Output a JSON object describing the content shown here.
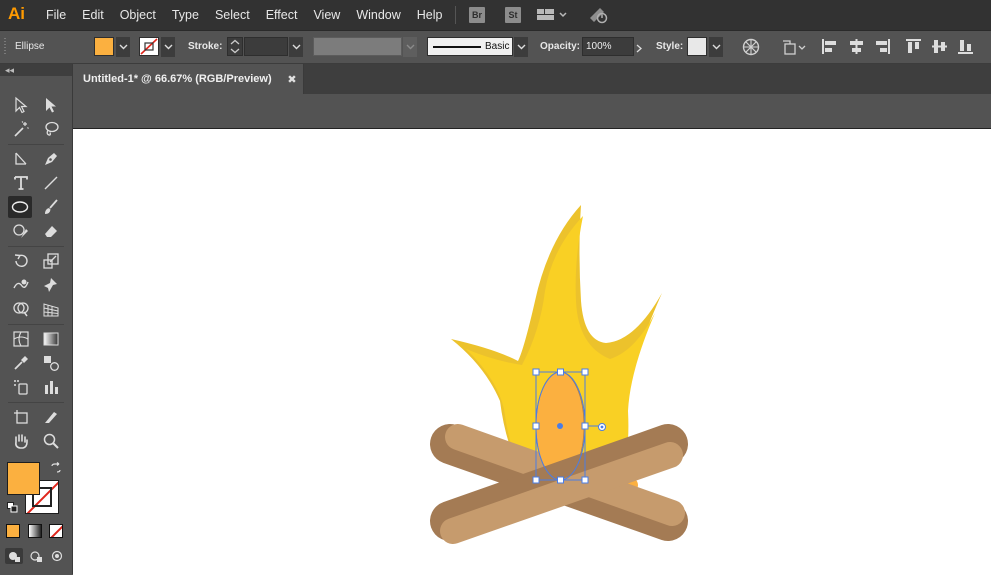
{
  "app": {
    "logo_text": "Ai"
  },
  "menubar": {
    "items": [
      "File",
      "Edit",
      "Object",
      "Type",
      "Select",
      "Effect",
      "View",
      "Window",
      "Help"
    ],
    "bridge_badge": "Br",
    "stock_badge": "St",
    "arrange_icon": "workspace-arrange-icon",
    "gpu_icon": "gpu-performance-icon"
  },
  "controlbar": {
    "selection_label": "Ellipse",
    "fill_color": "#FBB040",
    "stroke_label": "Stroke:",
    "stroke_weight": "",
    "brush_label": "Basic",
    "opacity_label": "Opacity:",
    "opacity_value": "100%",
    "style_label": "Style:"
  },
  "document": {
    "tab_title": "Untitled-1* @ 66.67% (RGB/Preview)",
    "close_glyph": "✖"
  },
  "toolbox": {
    "fill_swatch": "#FBB040",
    "stroke_swatch": "none",
    "tools": [
      "selection-tool-icon",
      "direct-selection-tool-icon",
      "magic-wand-tool-icon",
      "lasso-tool-icon",
      "line-tool-icon",
      "pen-tool-icon",
      "type-tool-icon",
      "line-segment-tool-icon",
      "ellipse-tool-icon",
      "paintbrush-tool-icon",
      "shaper-tool-icon",
      "eraser-tool-icon",
      "rotate-tool-icon",
      "scale-tool-icon",
      "warp-tool-icon",
      "puppet-warp-tool-icon",
      "shape-builder-tool-icon",
      "perspective-grid-tool-icon",
      "mesh-tool-icon",
      "gradient-tool-icon",
      "eyedropper-tool-icon",
      "blend-tool-icon",
      "symbol-sprayer-tool-icon",
      "column-graph-tool-icon",
      "artboard-tool-icon",
      "slice-tool-icon",
      "hand-tool-icon",
      "zoom-tool-icon"
    ],
    "active_tool": "ellipse-tool-icon"
  },
  "colors": {
    "flame_light": "#F9D024",
    "flame_dark": "#ECC22C",
    "ember_orange": "#FBB040",
    "log_light": "#C69B6D",
    "log_dark": "#A47B54",
    "selection_blue": "#4A7DE5"
  }
}
